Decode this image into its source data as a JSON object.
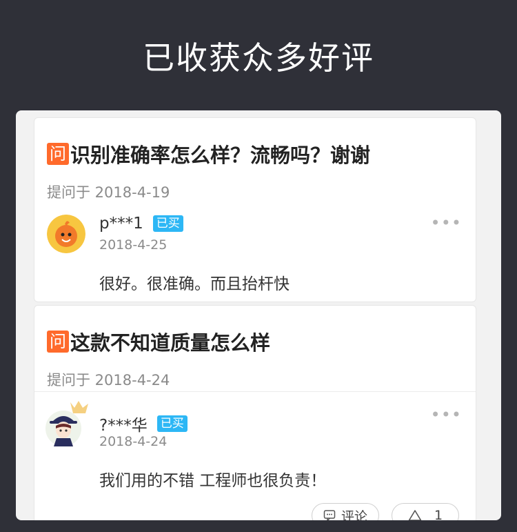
{
  "header": {
    "title": "已收获众多好评"
  },
  "questions": [
    {
      "badge": "问",
      "text": "识别准确率怎么样？流畅吗？谢谢",
      "asked": "提问于 2018-4-19",
      "answer": {
        "user": "p***1",
        "badge": "已买",
        "date": "2018-4-25",
        "text": "很好。很准确。而且抬杆快",
        "more": "•••"
      }
    },
    {
      "badge": "问",
      "text": "这款不知道质量怎么样",
      "asked": "提问于 2018-4-24",
      "answer": {
        "user": "?***华",
        "badge": "已买",
        "date": "2018-4-24",
        "text": "我们用的不错 工程师也很负责！",
        "more": "•••",
        "comment_label": "评论",
        "like_count": "1"
      }
    }
  ],
  "colors": {
    "background": "#2f3038",
    "question_badge": "#ff6a2b",
    "bought_badge": "#2db7f5"
  },
  "icons": [
    "comment-icon",
    "like-triangle-icon",
    "more-dots-icon",
    "crown-icon"
  ]
}
